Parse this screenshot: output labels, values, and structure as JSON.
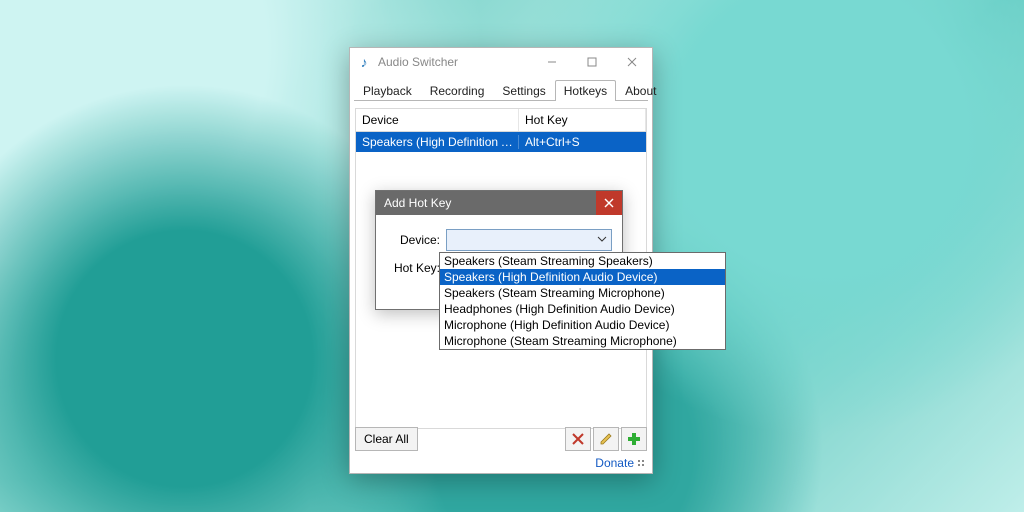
{
  "window": {
    "title": "Audio Switcher",
    "tabs": [
      "Playback",
      "Recording",
      "Settings",
      "Hotkeys",
      "About"
    ],
    "active_tab": 3
  },
  "table": {
    "columns": [
      "Device",
      "Hot Key"
    ],
    "rows": [
      {
        "device": "Speakers (High Definition A...",
        "hotkey": "Alt+Ctrl+S"
      }
    ]
  },
  "footer": {
    "clear_all": "Clear All",
    "donate": "Donate"
  },
  "dialog": {
    "title": "Add Hot Key",
    "labels": {
      "device": "Device:",
      "hotkey": "Hot Key:"
    }
  },
  "dropdown": {
    "options": [
      "Speakers (Steam Streaming Speakers)",
      "Speakers (High Definition Audio Device)",
      "Speakers (Steam Streaming Microphone)",
      "Headphones (High Definition Audio Device)",
      "Microphone (High Definition Audio Device)",
      "Microphone (Steam Streaming Microphone)"
    ],
    "selected_index": 1
  },
  "icons": {
    "delete": "delete-icon",
    "edit": "edit-icon",
    "add": "add-icon"
  }
}
